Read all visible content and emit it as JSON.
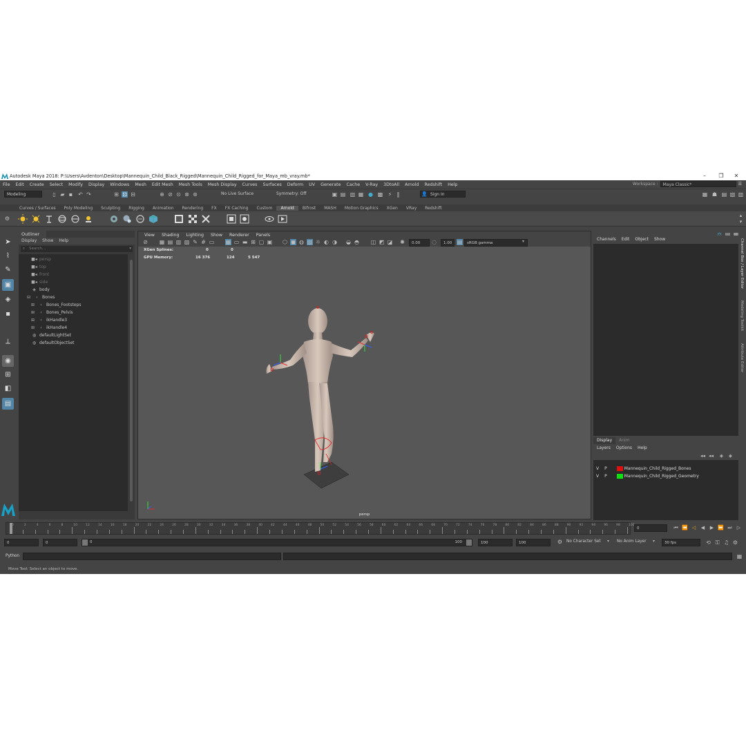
{
  "window": {
    "title": "Autodesk Maya 2018: P:\\Users\\Avdenton\\Desktop\\Mannequin_Child_Black_Rigged\\Mannequin_Child_Rigged_for_Maya_mb_vray.mb*",
    "minimize": "–",
    "maximize": "❐",
    "close": "✕"
  },
  "menubar": [
    "File",
    "Edit",
    "Create",
    "Select",
    "Modify",
    "Display",
    "Windows",
    "Mesh",
    "Edit Mesh",
    "Mesh Tools",
    "Mesh Display",
    "Curves",
    "Surfaces",
    "Deform",
    "UV",
    "Generate",
    "Cache",
    "V-Ray",
    "3DtoAll",
    "Arnold",
    "Redshift",
    "Help"
  ],
  "workspace": {
    "label": "Workspace :",
    "value": "Maya Classic*"
  },
  "statusline": {
    "mode": "Modeling",
    "live_surface": "No Live Surface",
    "symmetry": "Symmetry: Off",
    "sign_in": "Sign In"
  },
  "shelf_tabs": [
    "Curves / Surfaces",
    "Poly Modeling",
    "Sculpting",
    "Rigging",
    "Animation",
    "Rendering",
    "FX",
    "FX Caching",
    "Custom",
    "Arnold",
    "Bifrost",
    "MASH",
    "Motion Graphics",
    "XGen",
    "VRay",
    "Redshift"
  ],
  "shelf_active": "Arnold",
  "outliner": {
    "title": "Outliner",
    "menu": [
      "Display",
      "Show",
      "Help"
    ],
    "search_placeholder": "Search...",
    "items": [
      {
        "label": "persp",
        "dim": true,
        "icon": "camera-icon"
      },
      {
        "label": "top",
        "dim": true,
        "icon": "camera-icon"
      },
      {
        "label": "front",
        "dim": true,
        "icon": "camera-icon"
      },
      {
        "label": "side",
        "dim": true,
        "icon": "camera-icon"
      },
      {
        "label": "body",
        "dim": false,
        "icon": "mesh-icon"
      },
      {
        "label": "Bones",
        "dim": false,
        "icon": "joint-icon"
      },
      {
        "label": "Bones_Footsteps",
        "dim": false,
        "icon": "joint-icon"
      },
      {
        "label": "Bones_Pelvis",
        "dim": false,
        "icon": "joint-icon"
      },
      {
        "label": "ikHandle3",
        "dim": false,
        "icon": "ik-handle-icon"
      },
      {
        "label": "ikHandle4",
        "dim": false,
        "icon": "ik-handle-icon"
      },
      {
        "label": "defaultLightSet",
        "dim": false,
        "icon": "set-icon"
      },
      {
        "label": "defaultObjectSet",
        "dim": false,
        "icon": "set-icon"
      }
    ]
  },
  "viewport": {
    "menu": [
      "View",
      "Shading",
      "Lighting",
      "Show",
      "Renderer",
      "Panels"
    ],
    "exposure": "0.00",
    "gamma": "1.00",
    "color_space": "sRGB gamma",
    "hud": {
      "xgen_label": "XGen Splines:",
      "xgen_values": [
        "0",
        "0"
      ],
      "gpu_label": "GPU Memory:",
      "gpu_values": [
        "16 376",
        "124",
        "5 547"
      ]
    },
    "camera": "persp"
  },
  "channel_box": {
    "menu": [
      "Channels",
      "Edit",
      "Object",
      "Show"
    ]
  },
  "layer_editor": {
    "tabs": [
      "Display",
      "Anim"
    ],
    "menu": [
      "Layers",
      "Options",
      "Help"
    ],
    "layers": [
      {
        "v": "V",
        "p": "P",
        "name": "Mannequin_Child_Rigged_Bones",
        "color": "#e01010"
      },
      {
        "v": "V",
        "p": "P",
        "name": "Mannequin_Child_Rigged_Geometry",
        "color": "#10e010"
      }
    ]
  },
  "side_tabs": [
    "Channel Box / Layer Editor",
    "Modeling Toolkit",
    "Attribute Editor"
  ],
  "timeline": {
    "ticks": [
      "0",
      "2",
      "4",
      "6",
      "8",
      "10",
      "12",
      "14",
      "16",
      "18",
      "20",
      "22",
      "24",
      "26",
      "28",
      "30",
      "32",
      "34",
      "36",
      "38",
      "40",
      "42",
      "44",
      "46",
      "48",
      "50",
      "52",
      "54",
      "56",
      "58",
      "60",
      "62",
      "64",
      "66",
      "68",
      "70",
      "72",
      "74",
      "76",
      "78",
      "80",
      "82",
      "84",
      "86",
      "88",
      "90",
      "92",
      "94",
      "96",
      "98",
      "100"
    ],
    "current_frame": "0"
  },
  "range": {
    "start": "0",
    "playback_start": "0",
    "slider_start": "0",
    "slider_end": "100",
    "playback_end": "100",
    "end": "100",
    "character_set": "No Character Set",
    "anim_layer": "No Anim Layer",
    "fps": "30 fps"
  },
  "command_line": {
    "label": "Python"
  },
  "help_line": "Move Tool: Select an object to move.",
  "colors": {
    "accent": "#5285a6",
    "bg": "#444444",
    "panel": "#2b2b2b"
  }
}
